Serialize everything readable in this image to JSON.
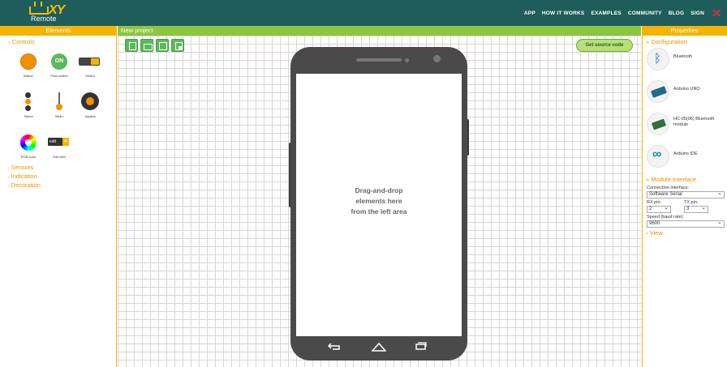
{
  "app": {
    "logo_text": "Remote",
    "logo_mark": "XY"
  },
  "nav": {
    "items": [
      "APP",
      "HOW IT WORKS",
      "EXAMPLES",
      "COMMUNITY",
      "BLOG",
      "SIGN"
    ]
  },
  "headers": {
    "left": "Elements",
    "center": "New project",
    "right": "Properties"
  },
  "left": {
    "controls_title": "Controls",
    "controls": [
      {
        "label": "Button"
      },
      {
        "label": "Push switch",
        "inner": "ON"
      },
      {
        "label": "Switch"
      },
      {
        "label": "Select"
      },
      {
        "label": "Slider"
      },
      {
        "label": "Joystick"
      },
      {
        "label": "RGB color"
      },
      {
        "label": "Edit field",
        "inner": "edit"
      }
    ],
    "collapsed_sections": [
      "Sensors",
      "Indication",
      "Decoration"
    ]
  },
  "canvas": {
    "get_source_label": "Get source code",
    "hint_lines": [
      "Drag-and-drop",
      "elements here",
      "from the left area"
    ]
  },
  "right": {
    "configuration_title": "Configuration",
    "configuration": [
      {
        "label": "Bluetooth",
        "icon": "bluetooth-icon"
      },
      {
        "label": "Arduino UNO",
        "icon": "arduino-board-icon"
      },
      {
        "label": "HC-05(06) Bluetooth module",
        "icon": "bluetooth-module-icon"
      },
      {
        "label": "Arduino IDE",
        "icon": "arduino-ide-icon"
      }
    ],
    "module_interface_title": "Module Interface",
    "connection_interface_label": "Connection interface:",
    "connection_interface_value": "Software Serial",
    "rx_pin_label": "RX pin:",
    "rx_pin_value": "2",
    "tx_pin_label": "TX pin:",
    "tx_pin_value": "3",
    "speed_label": "Speed (baud rate):",
    "speed_value": "9600",
    "view_title": "View"
  },
  "colors": {
    "topbar": "#1f5c5c",
    "accent_orange": "#f5b400",
    "accent_green": "#8cc63f",
    "text_orange": "#f29100",
    "phone_body": "#4a4a4a"
  }
}
